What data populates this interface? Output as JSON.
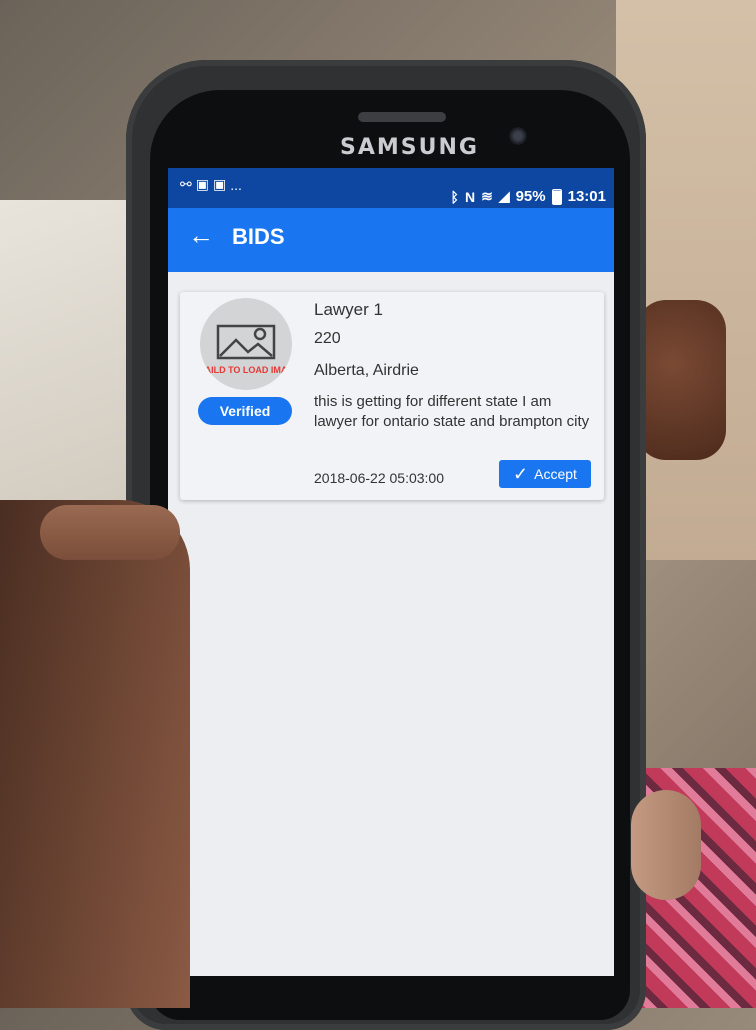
{
  "phone": {
    "brand": "SAMSUNG"
  },
  "status_bar": {
    "battery": "95%",
    "time": "13:01",
    "left_icons": [
      "link-icon",
      "image-icon",
      "image-icon"
    ],
    "more": "..."
  },
  "app_bar": {
    "title": "BIDS"
  },
  "bid": {
    "name": "Lawyer 1",
    "amount": "220",
    "location": "Alberta, Airdrie",
    "description": "this is getting for different state I am lawyer for ontario state and brampton city",
    "date": "2018-06-22 05:03:00",
    "image_error": "AILD TO LOAD IMA",
    "verified_label": "Verified",
    "accept_label": "Accept"
  },
  "colors": {
    "status_bar": "#0d47a1",
    "app_bar": "#1976f0",
    "accent": "#1976f0"
  }
}
